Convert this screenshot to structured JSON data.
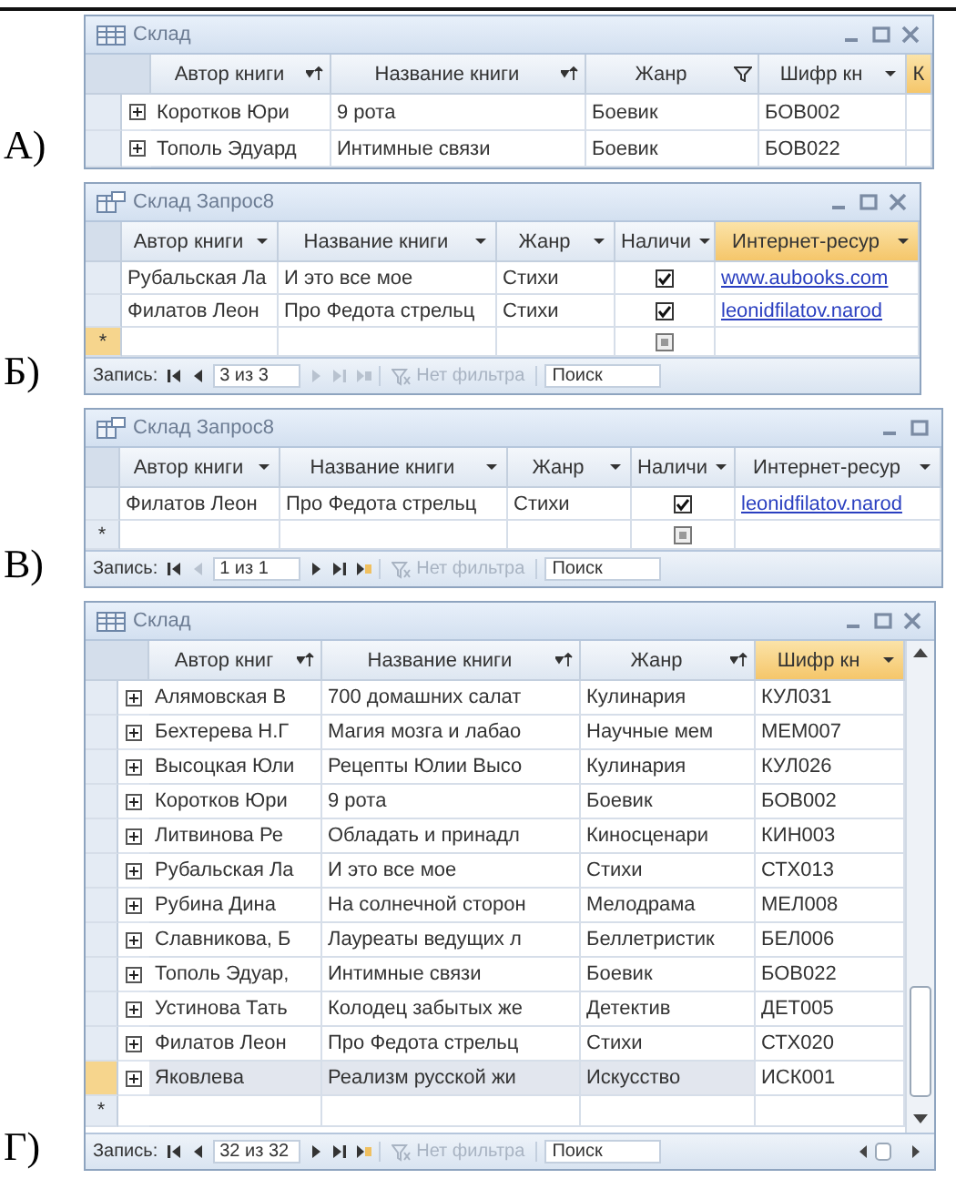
{
  "options": [
    {
      "label": "А)",
      "window": {
        "title": "Склад",
        "kind": "table",
        "controls": [
          {
            "kind": "minimize"
          },
          {
            "kind": "maximize"
          },
          {
            "kind": "close"
          }
        ],
        "expandable": true,
        "vertical_scrollbar": false,
        "columns": [
          {
            "label": "Автор книги",
            "kind": "text",
            "arrow": {
              "kind": "sort"
            },
            "selected": false
          },
          {
            "label": "Название книги",
            "kind": "text",
            "arrow": {
              "kind": "sort"
            },
            "selected": false
          },
          {
            "label": "Жанр",
            "kind": "text",
            "arrow": {
              "kind": "filter"
            },
            "selected": false
          },
          {
            "label": "Шифр кн",
            "kind": "text",
            "arrow": {
              "kind": "dropdown"
            },
            "selected": false
          },
          {
            "label": "К",
            "kind": "text",
            "selected": true
          }
        ],
        "rows": [
          {
            "selected": false,
            "expanded": false,
            "cells": [
              "Коротков Юри",
              "9 рота",
              "Боевик",
              "БОВ002",
              ""
            ]
          },
          {
            "selected": false,
            "expanded": false,
            "cells": [
              "Тополь Эдуард",
              "Интимные связи",
              "Боевик",
              "БОВ022",
              ""
            ]
          }
        ]
      }
    },
    {
      "label": "Б)",
      "window": {
        "title": "Склад Запрос8",
        "kind": "query",
        "controls": [
          {
            "kind": "minimize"
          },
          {
            "kind": "maximize"
          },
          {
            "kind": "close"
          }
        ],
        "expandable": false,
        "vertical_scrollbar": false,
        "columns": [
          {
            "label": "Автор книги",
            "kind": "text",
            "arrow": {
              "kind": "dropdown"
            },
            "selected": false
          },
          {
            "label": "Название книги",
            "kind": "text",
            "arrow": {
              "kind": "dropdown"
            },
            "selected": false
          },
          {
            "label": "Жанр",
            "kind": "text",
            "arrow": {
              "kind": "dropdown"
            },
            "selected": false
          },
          {
            "label": "Наличи",
            "kind": "check",
            "arrow": {
              "kind": "dropdown"
            },
            "selected": false
          },
          {
            "label": "Интернет-ресур",
            "kind": "link",
            "arrow": {
              "kind": "dropdown"
            },
            "selected": true
          }
        ],
        "rows": [
          {
            "selected": false,
            "cells": [
              "Рубальская Ла",
              "И это все мое",
              "Стихи",
              true,
              "www.aubooks.com"
            ]
          },
          {
            "selected": false,
            "cells": [
              "Филатов Леон",
              "Про Федота стрельц",
              "Стихи",
              true,
              "leonidfilatov.narod"
            ]
          }
        ],
        "new_row": {
          "marker": "*",
          "selected": true,
          "indeterminate": true
        },
        "nav": {
          "label": "Запись:",
          "position": "3 из 3",
          "buttons": [
            {
              "kind": "first",
              "disabled": false
            },
            {
              "kind": "prev",
              "disabled": false
            },
            {
              "kind": "next",
              "disabled": true
            },
            {
              "kind": "last",
              "disabled": true
            },
            {
              "kind": "new",
              "disabled": true
            }
          ],
          "filter": "Нет фильтра",
          "search": "Поиск",
          "horizontal_scrollbar": false
        }
      }
    },
    {
      "label": "В)",
      "window": {
        "title": "Склад Запрос8",
        "kind": "query",
        "controls": [
          {
            "kind": "minimize"
          },
          {
            "kind": "maximize"
          }
        ],
        "expandable": false,
        "vertical_scrollbar": false,
        "columns": [
          {
            "label": "Автор книги",
            "kind": "text",
            "arrow": {
              "kind": "dropdown"
            },
            "selected": false
          },
          {
            "label": "Название книги",
            "kind": "text",
            "arrow": {
              "kind": "dropdown"
            },
            "selected": false
          },
          {
            "label": "Жанр",
            "kind": "text",
            "arrow": {
              "kind": "dropdown"
            },
            "selected": false
          },
          {
            "label": "Наличи",
            "kind": "check",
            "arrow": {
              "kind": "dropdown"
            },
            "selected": false
          },
          {
            "label": "Интернет-ресур",
            "kind": "link",
            "arrow": {
              "kind": "dropdown"
            },
            "selected": false
          }
        ],
        "rows": [
          {
            "selected": false,
            "cells": [
              "Филатов Леон",
              "Про Федота стрельц",
              "Стихи",
              true,
              "leonidfilatov.narod"
            ]
          }
        ],
        "new_row": {
          "marker": "*",
          "selected": false,
          "indeterminate": true
        },
        "nav": {
          "label": "Запись:",
          "position": "1 из 1",
          "buttons": [
            {
              "kind": "first",
              "disabled": false
            },
            {
              "kind": "prev",
              "disabled": true
            },
            {
              "kind": "next",
              "disabled": false
            },
            {
              "kind": "last",
              "disabled": false
            },
            {
              "kind": "new",
              "disabled": false
            }
          ],
          "filter": "Нет фильтра",
          "search": "Поиск",
          "horizontal_scrollbar": false
        }
      }
    },
    {
      "label": "Г)",
      "window": {
        "title": "Склад",
        "kind": "table",
        "controls": [
          {
            "kind": "minimize"
          },
          {
            "kind": "maximize"
          },
          {
            "kind": "close"
          }
        ],
        "expandable": true,
        "vertical_scrollbar": true,
        "columns": [
          {
            "label": "Автор книг",
            "kind": "text",
            "arrow": {
              "kind": "sort"
            },
            "selected": false
          },
          {
            "label": "Название книги",
            "kind": "text",
            "arrow": {
              "kind": "sort"
            },
            "selected": false
          },
          {
            "label": "Жанр",
            "kind": "text",
            "arrow": {
              "kind": "sort"
            },
            "selected": false
          },
          {
            "label": "Шифр кн",
            "kind": "text",
            "arrow": {
              "kind": "dropdown"
            },
            "selected": true
          }
        ],
        "rows": [
          {
            "selected": false,
            "expanded": false,
            "cells": [
              "Алямовская В",
              "700 домашних салат",
              "Кулинария",
              "КУЛ031"
            ]
          },
          {
            "selected": false,
            "expanded": false,
            "cells": [
              "Бехтерева Н.Г",
              "Магия мозга и лабао",
              "Научные мем",
              "МЕМ007"
            ]
          },
          {
            "selected": false,
            "expanded": false,
            "cells": [
              "Высоцкая Юли",
              "Рецепты Юлии Высо",
              "Кулинария",
              "КУЛ026"
            ]
          },
          {
            "selected": false,
            "expanded": false,
            "cells": [
              "Коротков Юри",
              "9 рота",
              "Боевик",
              "БОВ002"
            ]
          },
          {
            "selected": false,
            "expanded": false,
            "cells": [
              "Литвинова Ре",
              "Обладать  и принадл",
              "Киносценари",
              "КИН003"
            ]
          },
          {
            "selected": false,
            "expanded": false,
            "cells": [
              "Рубальская Ла",
              "И это все мое",
              "Стихи",
              "СТХ013"
            ]
          },
          {
            "selected": false,
            "expanded": false,
            "cells": [
              "Рубина Дина",
              "На солнечной сторон",
              "Мелодрама",
              "МЕЛ008"
            ]
          },
          {
            "selected": false,
            "expanded": false,
            "cells": [
              "Славникова, Б",
              "Лауреаты ведущих л",
              "Беллетристик",
              "БЕЛ006"
            ]
          },
          {
            "selected": false,
            "expanded": false,
            "cells": [
              "Тополь Эдуар,",
              "Интимные связи",
              "Боевик",
              "БОВ022"
            ]
          },
          {
            "selected": false,
            "expanded": false,
            "cells": [
              "Устинова Тать",
              "Колодец забытых же",
              "Детектив",
              "ДЕТ005"
            ]
          },
          {
            "selected": false,
            "expanded": false,
            "cells": [
              "Филатов Леон",
              "Про Федота стрельц",
              "Стихи",
              "СТХ020"
            ]
          },
          {
            "selected": true,
            "expanded": false,
            "cells": [
              "Яковлева",
              "Реализм русской жи",
              "Искусство",
              "ИСК001"
            ]
          }
        ],
        "new_row": {
          "marker": "*",
          "selected": false
        },
        "nav": {
          "label": "Запись:",
          "position": "32 из 32",
          "buttons": [
            {
              "kind": "first",
              "disabled": false
            },
            {
              "kind": "prev",
              "disabled": false
            },
            {
              "kind": "next",
              "disabled": false
            },
            {
              "kind": "last",
              "disabled": false
            },
            {
              "kind": "new",
              "disabled": false
            }
          ],
          "filter": "Нет фильтра",
          "search": "Поиск",
          "horizontal_scrollbar": true
        }
      }
    }
  ]
}
